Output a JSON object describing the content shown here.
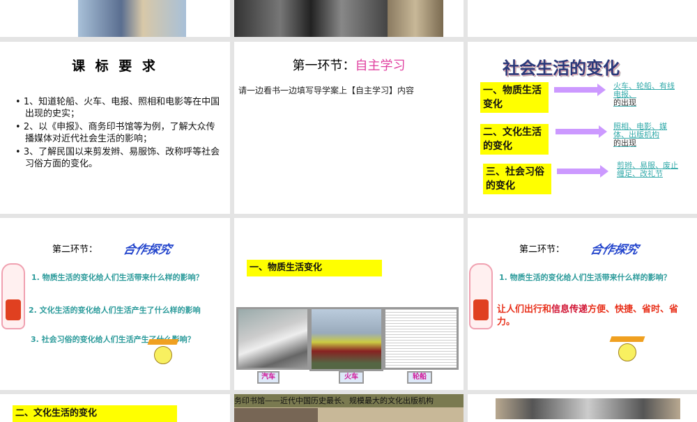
{
  "slide_standards": {
    "title": "课 标 要 求",
    "items": [
      "1、知道轮船、火车、电报、照相和电影等在中国出现的史实；",
      "2、以《申报》、商务印书馆等为例，了解大众传播媒体对近代社会生活的影响；",
      "3、了解民国以来剪发辫、易服饰、改称呼等社会习俗方面的变化。"
    ]
  },
  "slide_section1": {
    "title_prefix": "第一环节：",
    "title_highlight": "自主学习",
    "instruction": "请一边看书一边填写导学案上【自主学习】内容"
  },
  "slide_changes": {
    "title": "社会生活的变化",
    "rows": [
      {
        "box": "一、物质生活变化",
        "link": "火车、轮船、有线电报、",
        "suffix": "的出现"
      },
      {
        "box": "二、文化生活的变化",
        "link": "照相、电影、媒体、出版机构",
        "suffix": "的出现"
      },
      {
        "box": "三、社会习俗的变化",
        "link": "剪辫、易服、废止缠足、改礼节",
        "suffix": ""
      }
    ]
  },
  "slide_section2": {
    "label": "第二环节：",
    "wordart": "合作探究",
    "questions": [
      "1. 物质生活的变化给人们生活带来什么样的影响？",
      "2. 文化生活的变化给人们生活产生了什么样的影响",
      "3. 社会习俗的变化给人们生活产生了什么影响？"
    ]
  },
  "slide_material": {
    "heading": "一、物质生活变化",
    "captions": [
      "汽车",
      "火车",
      "轮船"
    ]
  },
  "slide_answer": {
    "label": "第二环节：",
    "wordart": "合作探究",
    "question": "1. 物质生活的变化给人们生活带来什么样的影响？",
    "answer_a": "让人们出行和",
    "answer_b": "信息传递",
    "answer_c": "方便、快捷、省时、省力。"
  },
  "slide_culture": {
    "heading": "二、文化生活的变化"
  },
  "slide_press": {
    "banner": "务印书馆——近代中国历史最长、规模最大的文化出版机构"
  },
  "colors": {
    "background": "#e4e4e4",
    "yellow": "#ffff00",
    "teal": "#2a9a9a",
    "arrow": "#cc99ff",
    "red": "#e8301a"
  }
}
